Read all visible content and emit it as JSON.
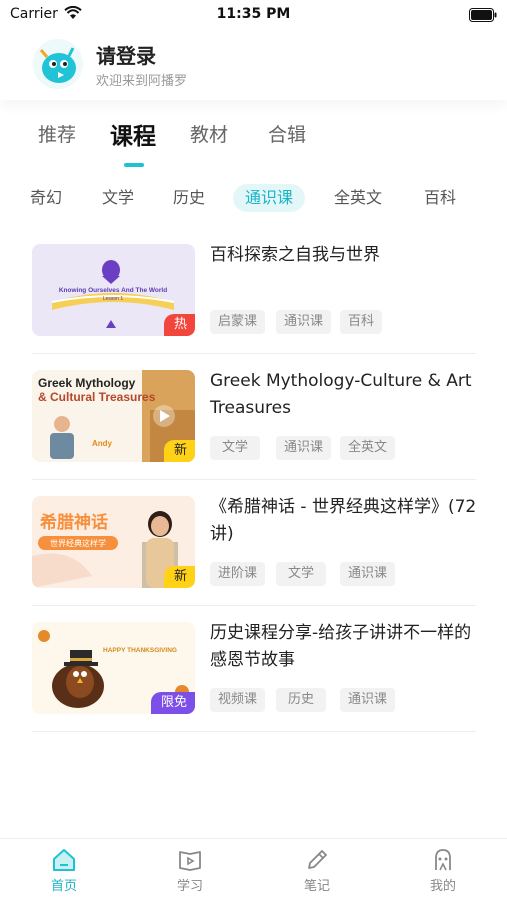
{
  "status_bar": {
    "carrier": "Carrier",
    "time": "11:35 PM"
  },
  "header": {
    "title": "请登录",
    "subtitle": "欢迎来到阿播罗"
  },
  "main_tabs": [
    {
      "label": "推荐"
    },
    {
      "label": "课程",
      "active": true
    },
    {
      "label": "教材"
    },
    {
      "label": "合辑"
    }
  ],
  "sub_tabs": [
    {
      "label": "奇幻"
    },
    {
      "label": "文学"
    },
    {
      "label": "历史"
    },
    {
      "label": "通识课",
      "active": true
    },
    {
      "label": "全英文"
    },
    {
      "label": "百科"
    }
  ],
  "courses": [
    {
      "title": "百科探索之自我与世界",
      "badge": "热",
      "thumb_text": "Knowing Ourselves And The World",
      "thumb_sub": "Lesson 1",
      "tags": [
        "启蒙课",
        "通识课",
        "百科"
      ]
    },
    {
      "title": "Greek Mythology-Culture & Art Treasures",
      "badge": "新",
      "thumb_text": "Greek Mythology",
      "thumb_text2": "& Cultural Treasures",
      "thumb_name": "Andy",
      "tags": [
        "文学",
        "通识课",
        "全英文"
      ]
    },
    {
      "title": "《希腊神话 - 世界经典这样学》(72讲)",
      "badge": "新",
      "thumb_text": "希腊神话",
      "thumb_sub": "世界经典这样学",
      "tags": [
        "进阶课",
        "文学",
        "通识课"
      ]
    },
    {
      "title": "历史课程分享-给孩子讲讲不一样的感恩节故事",
      "badge": "限免",
      "thumb_text": "HAPPY THANKSGIVING",
      "tags": [
        "视频课",
        "历史",
        "通识课"
      ]
    }
  ],
  "bottom_nav": [
    {
      "label": "首页",
      "icon": "home-icon",
      "active": true
    },
    {
      "label": "学习",
      "icon": "play-book-icon"
    },
    {
      "label": "笔记",
      "icon": "pencil-icon"
    },
    {
      "label": "我的",
      "icon": "profile-icon"
    }
  ],
  "colors": {
    "accent": "#1ec2d4",
    "hot": "#f2463d",
    "new": "#ffd217",
    "free": "#7b4fe8"
  }
}
